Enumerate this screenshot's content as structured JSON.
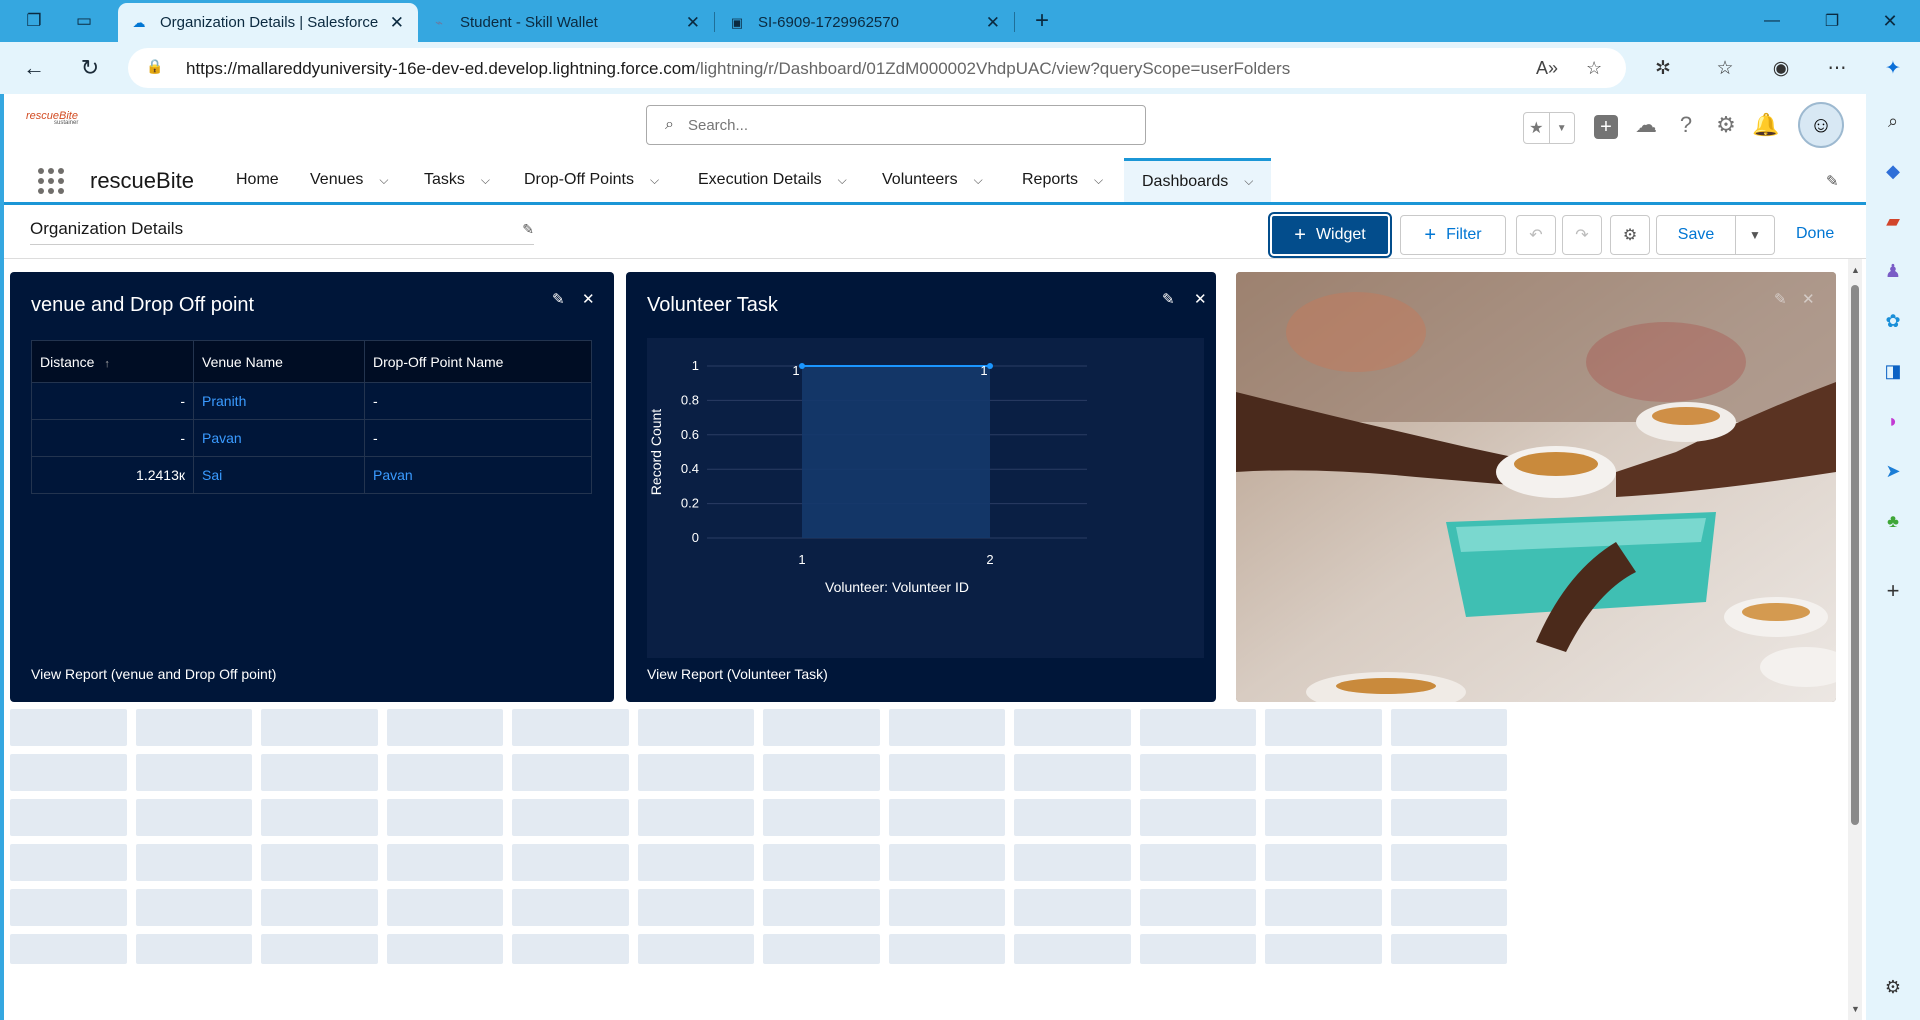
{
  "browser": {
    "tabs": [
      {
        "title": "Organization Details | Salesforce",
        "active": true
      },
      {
        "title": "Student - Skill Wallet",
        "active": false
      },
      {
        "title": "SI-6909-1729962570",
        "active": false
      }
    ],
    "url_host": "https://mallareddyuniversity-16e-dev-ed.develop.lightning.force.com",
    "url_path": "/lightning/r/Dashboard/01ZdM000002VhdpUAC/view?queryScope=userFolders"
  },
  "sf": {
    "logo_text": "rescueBite",
    "logo_sub": "sustainer",
    "search_placeholder": "Search...",
    "app_name": "rescueBite",
    "nav": [
      "Home",
      "Venues",
      "Tasks",
      "Drop-Off Points",
      "Execution Details",
      "Volunteers",
      "Reports",
      "Dashboards"
    ]
  },
  "dashboard": {
    "title": "Organization Details",
    "buttons": {
      "widget": "Widget",
      "filter": "Filter",
      "save": "Save",
      "done": "Done"
    }
  },
  "widget1": {
    "title": "venue and Drop Off point",
    "columns": [
      "Distance",
      "Venue Name",
      "Drop-Off Point Name"
    ],
    "rows": [
      [
        "-",
        "Pranith",
        "-"
      ],
      [
        "-",
        "Pavan",
        "-"
      ],
      [
        "1.2413к",
        "Sai",
        "Pavan"
      ]
    ],
    "footer": "View Report (venue and Drop Off point)"
  },
  "widget2": {
    "title": "Volunteer Task",
    "footer": "View Report (Volunteer Task)"
  },
  "chart_data": {
    "type": "area",
    "title": "",
    "xlabel": "Volunteer: Volunteer ID",
    "ylabel": "Record Count",
    "categories": [
      "1",
      "2"
    ],
    "values": [
      1,
      1
    ],
    "data_labels": [
      "1",
      "1"
    ],
    "yticks": [
      "0",
      "0.2",
      "0.4",
      "0.6",
      "0.8",
      "1"
    ],
    "ylim": [
      0,
      1
    ],
    "grid": true,
    "colors": {
      "line": "#1b96ff",
      "fill": "#14386b"
    }
  }
}
